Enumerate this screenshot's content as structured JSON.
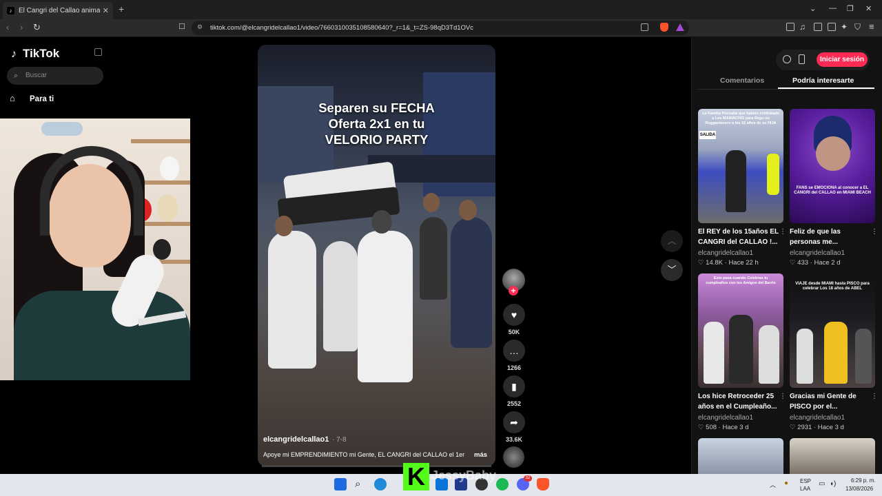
{
  "browser": {
    "tab_title": "El Cangri del Callao animador de",
    "tab_close": "✕",
    "new_tab": "+",
    "url": "tiktok.com/@elcangridelcallao1/video/7660310035108580640?_r=1&_t=ZS-98qD3Td1OVc"
  },
  "sidebar": {
    "logo": "TikTok",
    "search_placeholder": "Buscar",
    "nav_for_you": "Para ti"
  },
  "video": {
    "caption_lines": [
      "Separen su FECHA",
      "Oferta 2x1 en tu",
      "VELORIO PARTY"
    ],
    "author": "elcangridelcallao1",
    "date": "· 7-8",
    "description": "Apoye mi EMPRENDIMIENTO mi Gente, EL CANGRI del CALLAO el 1er",
    "more": "más"
  },
  "actions": {
    "likes": "50K",
    "comments": "1266",
    "saves": "2552",
    "shares": "33.6K"
  },
  "right_panel": {
    "login": "Iniciar sesión",
    "tab_comments": "Comentarios",
    "tab_interest": "Podría interesarte",
    "cards": [
      {
        "overlay": "La Familia Ponsalia que habían contratado a Los MARIACHIS para Rego un Reggaetonero a los 15 años de su HIJA",
        "title_1": "El REY de los 15años EL",
        "title_2": "CANGRI del CALLAO !...",
        "user": "elcangridelcallao1",
        "likes": "14.8K",
        "ago": "Hace 22 h",
        "sign": "SALIDA"
      },
      {
        "overlay": "FANS se EMOCIONA al conocer a EL CANGRI del CALLAO en MIAMI BEACH",
        "title_1": "Feliz de que las",
        "title_2": "personas me...",
        "user": "elcangridelcallao1",
        "likes": "433",
        "ago": "Hace 2 d"
      },
      {
        "overlay": "Esto pasa cuando Celebras tu cumpleaños con los Amigos del Barrio",
        "title_1": "Los hice Retroceder 25",
        "title_2": "años en el Cumpleaño...",
        "user": "elcangridelcallao1",
        "likes": "508",
        "ago": "Hace 3 d"
      },
      {
        "overlay": "VIAJE desde MIAMI hasta PISCO para celebrar Los 18 años de ABEL",
        "title_1": "Gracias mi Gente de",
        "title_2": "PISCO por el...",
        "user": "elcangridelcallao1",
        "likes": "2931",
        "ago": "Hace 3 d"
      }
    ]
  },
  "stream": {
    "watermark": "JessyBaby"
  },
  "taskbar": {
    "lang_1": "ESP",
    "lang_2": "LAA",
    "time": "6:29 p. m.",
    "date": "13/08/2026",
    "badge": "32"
  }
}
